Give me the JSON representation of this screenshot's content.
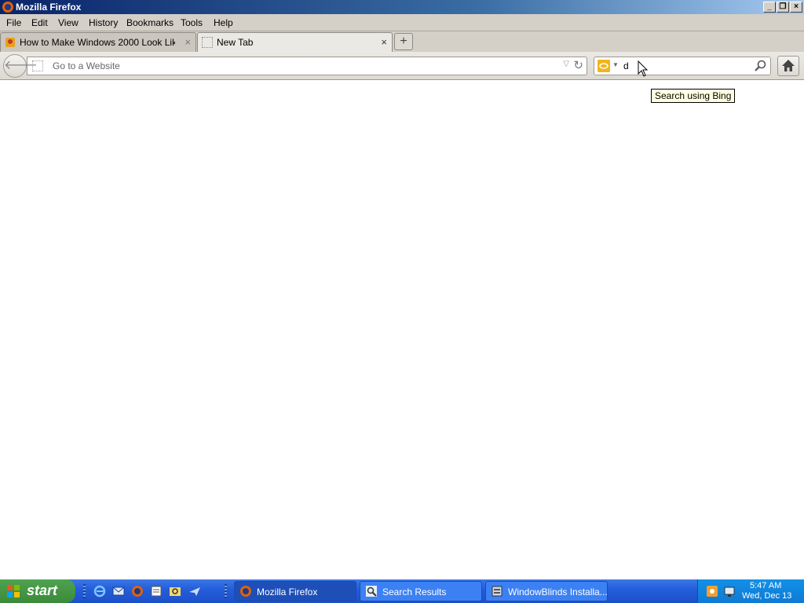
{
  "window": {
    "title": "Mozilla Firefox"
  },
  "menu": {
    "items": [
      "File",
      "Edit",
      "View",
      "History",
      "Bookmarks",
      "Tools",
      "Help"
    ]
  },
  "tabs": [
    {
      "label": "How to Make Windows 2000 Look Like ..."
    },
    {
      "label": "New Tab"
    }
  ],
  "nav": {
    "url_placeholder": "Go to a Website",
    "search_value": "d",
    "search_tooltip": "Search using Bing"
  },
  "taskbar": {
    "start_label": "start",
    "tasks": [
      {
        "label": "Mozilla Firefox"
      },
      {
        "label": "Search Results"
      },
      {
        "label": "WindowBlinds Installa..."
      }
    ],
    "clock_time": "5:47 AM",
    "clock_date": "Wed, Dec 13"
  },
  "colors": {
    "titlebar": "#0a246a",
    "taskbar": "#245edb",
    "start": "#3a8a3a",
    "bing": "#f2b41b"
  }
}
